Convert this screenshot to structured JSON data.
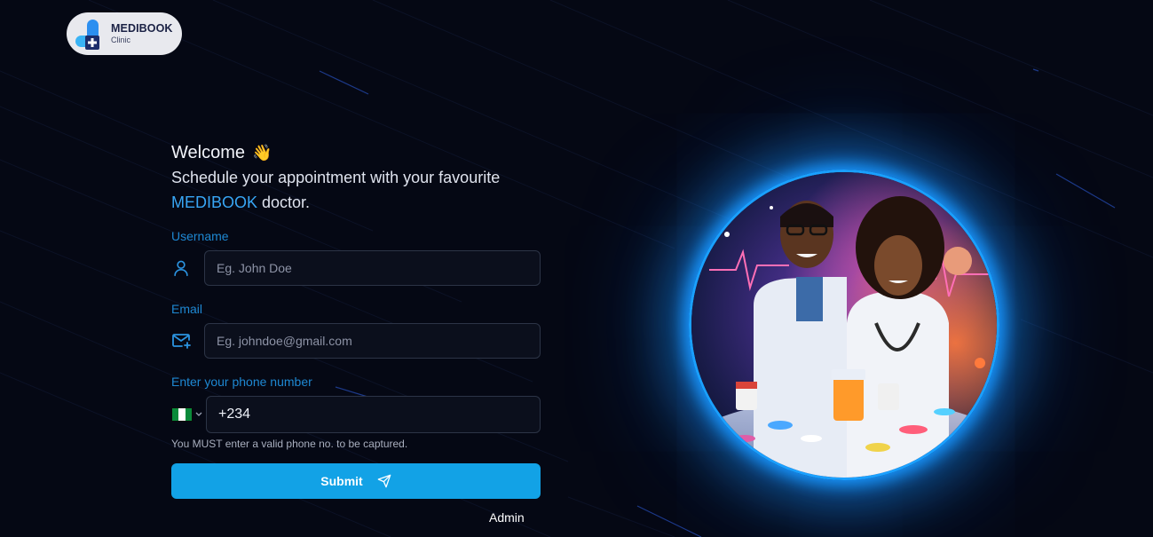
{
  "logo": {
    "name": "MEDIBOOK",
    "sub": "Clinic"
  },
  "welcome": {
    "title": "Welcome",
    "emoji": "👋"
  },
  "tagline": {
    "before": "Schedule your appointment with your favourite ",
    "brand": "MEDIBOOK",
    "after": " doctor."
  },
  "form": {
    "username_label": "Username",
    "username_placeholder": "Eg. John Doe",
    "email_label": "Email",
    "email_placeholder": "Eg. johndoe@gmail.com",
    "phone_label": "Enter your phone number",
    "phone_value": "+234",
    "phone_hint": "You MUST enter a valid phone no. to be captured.",
    "submit_label": "Submit"
  },
  "footer": {
    "admin_label": "Admin"
  },
  "colors": {
    "accent": "#12a2e6",
    "brand_text": "#38a6f5",
    "label": "#1e88d2",
    "background": "#050814",
    "glow": "#1aa0ff"
  },
  "icons": {
    "username": "user-icon",
    "email": "mail-plus-icon",
    "flag": "nigeria-flag-icon",
    "dropdown": "chevron-down-icon",
    "submit": "send-icon"
  }
}
